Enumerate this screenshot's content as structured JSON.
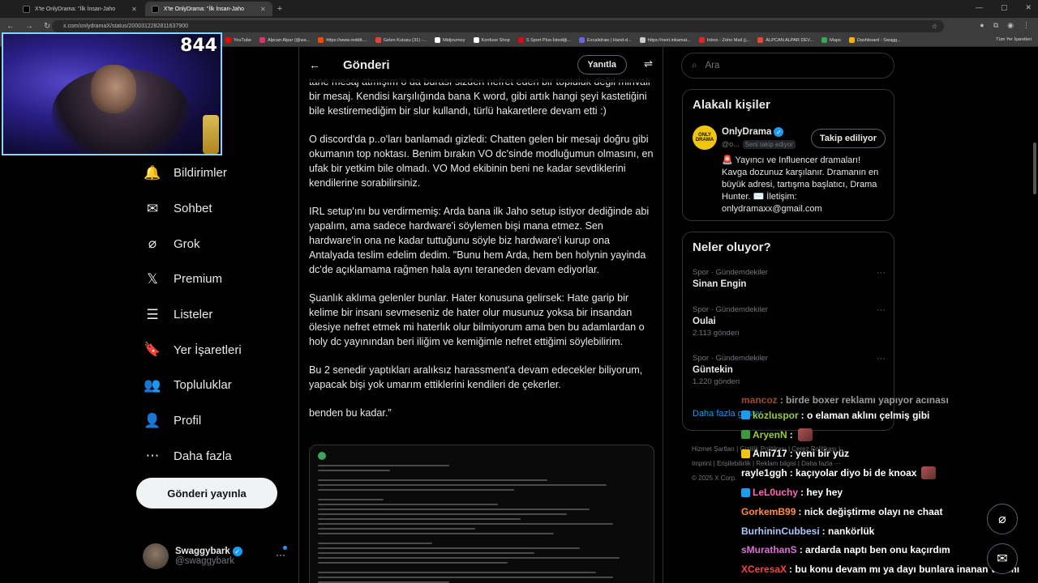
{
  "browser": {
    "tabs": [
      {
        "label": "X'te OnlyDrama: \"İlk İnsan-Jaho",
        "active": false
      },
      {
        "label": "X'te OnlyDrama: \"İlk İnsan-Jaho",
        "active": true
      }
    ],
    "url": "x.com/onlydramaX/status/2000312282811637900",
    "bookmarks": [
      {
        "label": "YouTube",
        "color": "#ff0000"
      },
      {
        "label": "Alpcan Alpar (@wa...",
        "color": "#e1306c"
      },
      {
        "label": "https://www.reddit....",
        "color": "#ff4500"
      },
      {
        "label": "Gelen Kutusu (31) -...",
        "color": "#ea4335"
      },
      {
        "label": "Midjourney",
        "color": "#ffffff"
      },
      {
        "label": "Konfuse Shop",
        "color": "#ffffff"
      },
      {
        "label": "S Sport Plus-İstediği...",
        "color": "#e30613"
      },
      {
        "label": "Excalidraw | Hand-d...",
        "color": "#6965db"
      },
      {
        "label": "https://next.inkamat...",
        "color": "#cccccc"
      },
      {
        "label": "Inbox - Zoho Mail (j...",
        "color": "#e42527"
      },
      {
        "label": "ALPCAN ALPAR DEV...",
        "color": "#ea4335"
      },
      {
        "label": "Maps",
        "color": "#34a853"
      },
      {
        "label": "Dashboard - Swagg...",
        "color": "#f4b400"
      }
    ],
    "all_bookmarks": "Tüm Yer İşaretleri"
  },
  "webcam": {
    "viewer_count": "844"
  },
  "nav": {
    "items": [
      {
        "label": "Bildirimler",
        "icon": "bell-icon",
        "glyph": "🔔"
      },
      {
        "label": "Sohbet",
        "icon": "envelope-icon",
        "glyph": "✉"
      },
      {
        "label": "Grok",
        "icon": "grok-icon",
        "glyph": "⌀"
      },
      {
        "label": "Premium",
        "icon": "x-logo-icon",
        "glyph": "𝕏"
      },
      {
        "label": "Listeler",
        "icon": "list-icon",
        "glyph": "☰"
      },
      {
        "label": "Yer İşaretleri",
        "icon": "bookmark-icon",
        "glyph": "🔖"
      },
      {
        "label": "Topluluklar",
        "icon": "communities-icon",
        "glyph": "👥"
      },
      {
        "label": "Profil",
        "icon": "profile-icon",
        "glyph": "👤"
      },
      {
        "label": "Daha fazla",
        "icon": "more-circle-icon",
        "glyph": "⋯"
      }
    ],
    "post_button": "Gönderi yayınla",
    "account": {
      "name": "Swaggybark",
      "handle": "@swaggybark"
    }
  },
  "main": {
    "title": "Gönderi",
    "reply_button": "Yanıtla",
    "paragraphs": [
      "tane mesaj atmışım o da burası sizden nefret eden bir topluluk değil minvali bir mesaj. Kendisi karşılığında bana K word, gibi artık hangi şeyi kastetiğini bile kestiremediğim bir slur kullandı, türlü hakaretlere devam etti :)",
      "O discord'da p..o'ları banlamadı gizledi: Chatten gelen bir mesajı doğru gibi okumanın top noktası. Benim bırakın VO dc'sinde modluğumun olmasını, en ufak bir yetkim bile olmadı. VO Mod ekibinin beni ne kadar sevdiklerini kendilerine sorabilirsiniz.",
      "IRL setup'ını bu verdirmemiş: Arda bana ilk Jaho setup istiyor dediğinde abi yapalım, ama sadece hardware'i söylemen bişi mana etmez. Sen hardware'in ona ne kadar tuttuğunu söyle biz hardware'i kurup ona Antalyada teslim edelim dedim. \"Bunu hem Arda, hem ben holynin yayinda dc'de açıklamama rağmen hala aynı teraneden devam ediyorlar.",
      "Şuanlık aklıma gelenler bunlar.  Hater konusuna gelirsek: Hate garip bir kelime bir insanı sevmeseniz de hater olur musunuz yoksa bir insandan ölesiye nefret etmek mi haterlık olur bilmiyorum ama ben bu adamlardan o holy dc yayınından beri iliğim ve kemiğimle nefret ettiğimi söylebilirim.",
      "Bu 2 senedir yaptıkları aralıksız harassment'a devam edecekler biliyorum, yapacak bişi yok umarım ettiklerini kendileri de çekerler.",
      "benden bu kadar.”"
    ]
  },
  "right": {
    "search_placeholder": "Ara",
    "related": {
      "title": "Alakalı kişiler",
      "name": "OnlyDrama",
      "logo_text": "ONLY DRAMA",
      "handle": "@o...",
      "follows_you": "Seni takip ediyor",
      "follow_button": "Takip ediliyor",
      "bio": "🚨 Yayıncı ve Influencer dramaları! Kavga dozunuz karşılanır. Dramanın en büyük adresi, tartışma başlatıcı, Drama Hunter. ✉️ İletişim: onlydramaxx@gmail.com"
    },
    "trends": {
      "title": "Neler oluyor?",
      "items": [
        {
          "category": "Spor · Gündemdekiler",
          "name": "Sinan Engin",
          "count": ""
        },
        {
          "category": "Spor · Gündemdekiler",
          "name": "Oulai",
          "count": "2.113 gönderi"
        },
        {
          "category": "Spor · Gündemdekiler",
          "name": "Güntekin",
          "count": "1.220 gönderi"
        }
      ],
      "show_more": "Daha fazla göster"
    },
    "footer": {
      "line1": "Hizmet Şartları  |  Gizlilik Politikası  |  Çerez Politikası  |",
      "line2": "Imprint  |  Erişilebilirlik  |  Reklam bilgisi  |  Daha fazla ···",
      "line3": "© 2025 X Corp."
    }
  },
  "chat": [
    {
      "user": "mancoz",
      "text": ": birde boxer reklamı yapıyor acınası",
      "color": "#ff7f50",
      "faded": true,
      "badge": ""
    },
    {
      "user": "kozluspor",
      "text": ": o elaman aklını çelmiş gibi",
      "color": "#9acd32",
      "faded": false,
      "badge": "#1d9bf0"
    },
    {
      "user": "AryenN",
      "text": ":",
      "color": "#9acd32",
      "faded": false,
      "badge": "#3c9a3c",
      "emote": true
    },
    {
      "user": "Ami717",
      "text": ": yeni bir yüz",
      "color": "#ffffff",
      "faded": false,
      "badge": "#f1c40f"
    },
    {
      "user": "rayle1ggh",
      "text": ": kaçıyolar diyo bi de knoax",
      "color": "#ffffff",
      "faded": false,
      "badge": "",
      "emote": true
    },
    {
      "user": "LeL0uchy",
      "text": ": hey hey",
      "color": "#ff69b4",
      "faded": false,
      "badge": "#1d9bf0"
    },
    {
      "user": "GorkemB99",
      "text": ": nick değiştirme olayı ne chaat",
      "color": "#ff8c3a",
      "faded": false,
      "badge": ""
    },
    {
      "user": "BurhininCubbesi",
      "text": ": nankörlük",
      "color": "#b0c4ff",
      "faded": false,
      "badge": ""
    },
    {
      "user": "sMurathanS",
      "text": ": ardarda naptı ben onu kaçırdım",
      "color": "#da70d6",
      "faded": false,
      "badge": ""
    },
    {
      "user": "XCeresaX",
      "text": ": bu konu devam mı ya dayı bunlara inanan var mı",
      "color": "#ff4040",
      "faded": false,
      "badge": ""
    }
  ]
}
